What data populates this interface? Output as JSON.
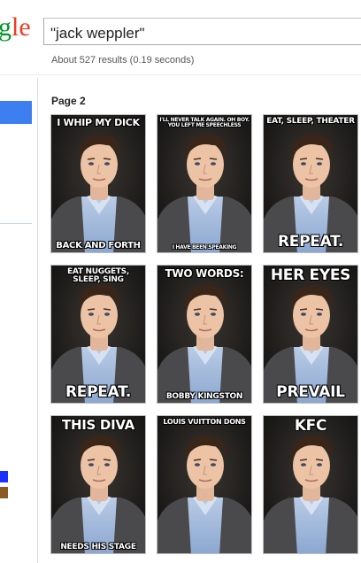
{
  "header": {
    "logo_fragment_a": "g",
    "logo_fragment_b": "le",
    "search_value": "\"jack weppler\"",
    "results_stats": "About 527 results (0.19 seconds)"
  },
  "colors": {
    "logo_green": "#009925",
    "logo_red": "#ee3b24",
    "sidebar_active": "#3d7ef0",
    "swatch_blue": "#1a30ff",
    "swatch_brown": "#8b5a24"
  },
  "page_label": "Page 2",
  "results": [
    {
      "top": "I WHIP MY DICK",
      "bottom": "BACK AND FORTH"
    },
    {
      "top": "I'LL NEVER TALK AGAIN. OH BOY. YOU LEFT ME SPEECHLESS",
      "bottom": "I HAVE BEEN SPEAKING"
    },
    {
      "top": "EAT, SLEEP, THEATER",
      "bottom": "REPEAT."
    },
    {
      "top": "EAT NUGGETS, SLEEP, SING",
      "bottom": "REPEAT."
    },
    {
      "top": "TWO WORDS:",
      "bottom": "BOBBY KINGSTON"
    },
    {
      "top": "HER EYES",
      "bottom": "PREVAIL"
    },
    {
      "top": "THIS DIVA",
      "bottom": "NEEDS HIS STAGE"
    },
    {
      "top": "LOUIS VUITTON DONS",
      "bottom": ""
    },
    {
      "top": "KFC",
      "bottom": ""
    }
  ]
}
